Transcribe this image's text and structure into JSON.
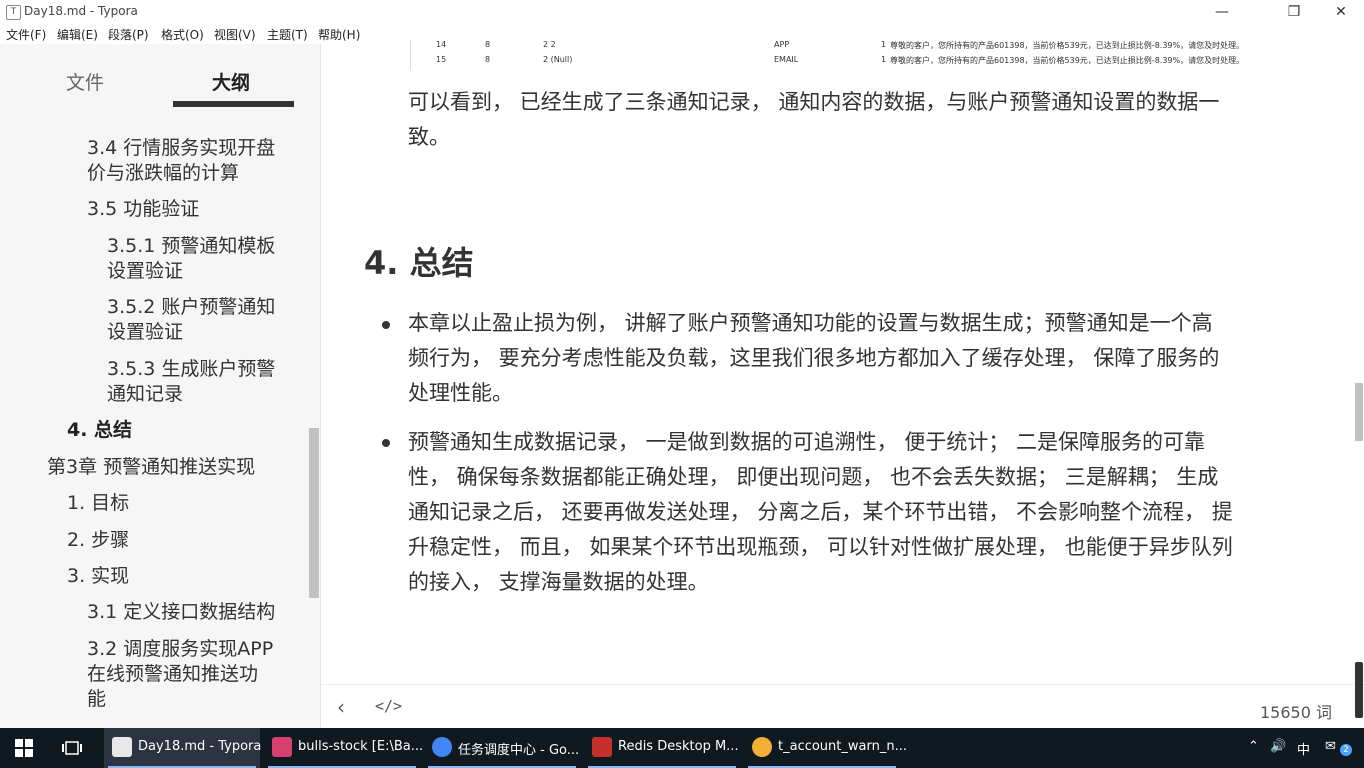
{
  "window": {
    "title": "Day18.md - Typora",
    "app_icon": "T"
  },
  "menu": [
    "文件(F)",
    "编辑(E)",
    "段落(P)",
    "格式(O)",
    "视图(V)",
    "主题(T)",
    "帮助(H)"
  ],
  "sidebar": {
    "tab_files": "文件",
    "tab_outline": "大纲",
    "items": [
      {
        "line1": "3.4 行情服务实现开盘",
        "line2": "价与涨跌幅的计算"
      },
      {
        "line1": "3.5 功能验证",
        "line2": ""
      },
      {
        "line1": "3.5.1 预警通知模板",
        "line2": "设置验证"
      },
      {
        "line1": "3.5.2 账户预警通知",
        "line2": "设置验证"
      },
      {
        "line1": "3.5.3 生成账户预警",
        "line2": "通知记录"
      },
      {
        "line1": "4. 总结",
        "line2": ""
      },
      {
        "line1": "第3章 预警通知推送实现",
        "line2": ""
      },
      {
        "line1": "1. 目标",
        "line2": ""
      },
      {
        "line1": "2. 步骤",
        "line2": ""
      },
      {
        "line1": "3. 实现",
        "line2": ""
      },
      {
        "line1": "3.1 定义接口数据结构",
        "line2": ""
      },
      {
        "line1": "3.2 调度服务实现APP",
        "line2": "在线预警通知推送功",
        "line3": "能"
      }
    ]
  },
  "table_rows": [
    {
      "c1": "14",
      "c2": "8",
      "c3": "2 2",
      "c4": "APP",
      "c5": "1",
      "c6": "尊敬的客户，您所持有的产品601398，当前价格539元，已达到止损比例-8.39%，请您及时处理。"
    },
    {
      "c1": "15",
      "c2": "8",
      "c3": "2 (Null)",
      "c4": "EMAIL",
      "c5": "1",
      "c6": "尊敬的客户，您所持有的产品601398，当前价格539元，已达到止损比例-8.39%，请您及时处理。"
    }
  ],
  "content": {
    "intro_line1": "可以看到， 已经生成了三条通知记录， 通知内容的数据，与账户预警通知设置的数据一",
    "intro_line2": "致。",
    "heading": "4. 总结",
    "bullet1": [
      "本章以止盈止损为例， 讲解了账户预警通知功能的设置与数据生成；预警通知是一个高",
      "频行为， 要充分考虑性能及负载，这里我们很多地方都加入了缓存处理， 保障了服务的",
      "处理性能。"
    ],
    "bullet2": [
      "预警通知生成数据记录， 一是做到数据的可追溯性， 便于统计； 二是保障服务的可靠",
      "性， 确保每条数据都能正确处理， 即便出现问题， 也不会丢失数据； 三是解耦； 生成",
      "通知记录之后， 还要再做发送处理， 分离之后，某个环节出错， 不会影响整个流程， 提",
      "升稳定性， 而且， 如果某个环节出现瓶颈， 可以针对性做扩展处理， 也能便于异步队列",
      "的接入， 支撑海量数据的处理。"
    ]
  },
  "footer": {
    "word_count": "15650 词",
    "back_icon": "chevron-left-icon",
    "source_icon": "code-icon"
  },
  "taskbar": {
    "items": [
      "Day18.md - Typora",
      "bulls-stock [E:\\Ba...",
      "任务调度中心 - Go...",
      "Redis Desktop M...",
      "t_account_warn_n..."
    ],
    "ime": "中",
    "notifications": "2"
  }
}
